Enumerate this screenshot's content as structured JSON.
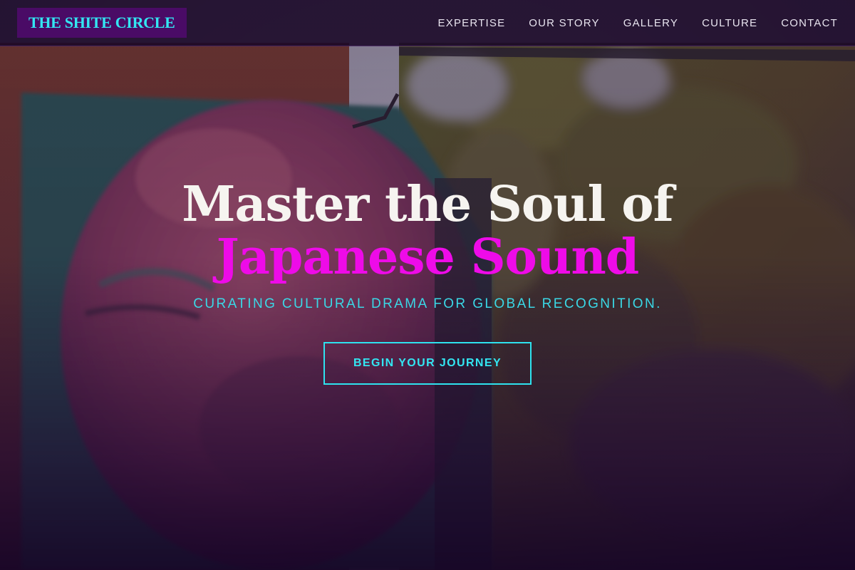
{
  "brand": {
    "name": "THE SHITE CIRCLE"
  },
  "nav": {
    "items": [
      {
        "label": "EXPERTISE"
      },
      {
        "label": "OUR STORY"
      },
      {
        "label": "GALLERY"
      },
      {
        "label": "CULTURE"
      },
      {
        "label": "CONTACT"
      }
    ]
  },
  "hero": {
    "headline_line1": "Master the Soul of",
    "headline_line2": "Japanese Sound",
    "tagline": "CURATING CULTURAL DRAMA FOR GLOBAL RECOGNITION.",
    "cta_label": "BEGIN YOUR JOURNEY"
  },
  "colors": {
    "nav_background": "#1a0828",
    "logo_background": "#4a0b66",
    "logo_text": "#33e6f2",
    "accent_magenta": "#ee0be8",
    "accent_cyan": "#33e6f2",
    "headline_text": "#f6f4f0"
  }
}
